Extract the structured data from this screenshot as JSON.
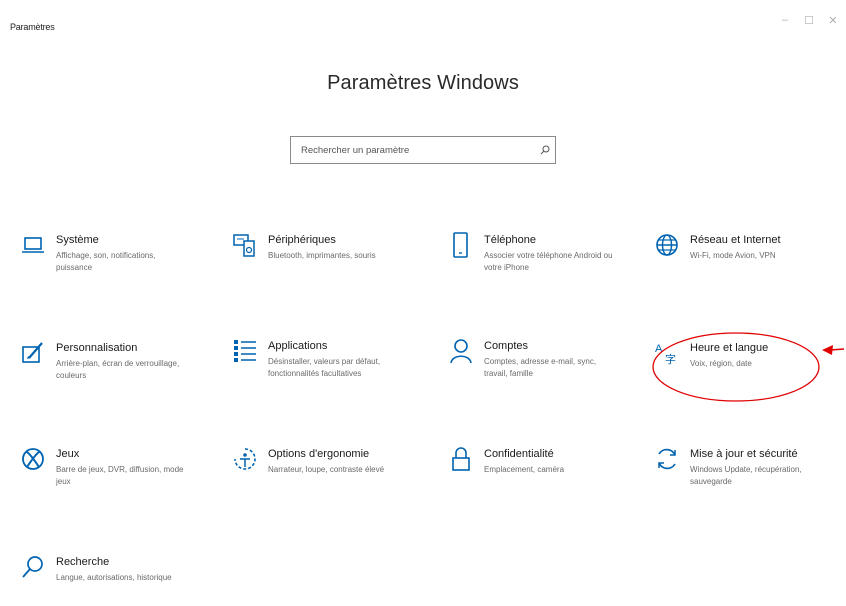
{
  "window": {
    "title": "Paramètres",
    "controls": {
      "minimize": "–",
      "maximize": "☐",
      "close": "✕"
    }
  },
  "header": {
    "title": "Paramètres Windows"
  },
  "search": {
    "placeholder": "Rechercher un paramètre"
  },
  "tiles": [
    {
      "name": "Système",
      "desc": "Affichage, son, notifications, puissance",
      "icon": "laptop-icon"
    },
    {
      "name": "Périphériques",
      "desc": "Bluetooth, imprimantes, souris",
      "icon": "devices-icon"
    },
    {
      "name": "Téléphone",
      "desc": "Associer votre téléphone Android ou votre iPhone",
      "icon": "phone-icon"
    },
    {
      "name": "Réseau et Internet",
      "desc": "Wi-Fi, mode Avion, VPN",
      "icon": "globe-icon"
    },
    {
      "name": "Personnalisation",
      "desc": "Arrière-plan, écran de verrouillage, couleurs",
      "icon": "personalization-icon"
    },
    {
      "name": "Applications",
      "desc": "Désinstaller, valeurs par défaut, fonctionnalités facultatives",
      "icon": "apps-list-icon"
    },
    {
      "name": "Comptes",
      "desc": "Comptes, adresse e-mail, sync, travail, famille",
      "icon": "person-icon"
    },
    {
      "name": "Heure et langue",
      "desc": "Voix, région, date",
      "icon": "time-language-icon"
    },
    {
      "name": "Jeux",
      "desc": "Barre de jeux, DVR, diffusion, mode jeux",
      "icon": "xbox-icon"
    },
    {
      "name": "Options d'ergonomie",
      "desc": "Narrateur, loupe, contraste élevé",
      "icon": "ease-of-access-icon"
    },
    {
      "name": "Confidentialité",
      "desc": "Emplacement, caméra",
      "icon": "lock-icon"
    },
    {
      "name": "Mise à jour et sécurité",
      "desc": "Windows Update, récupération, sauvegarde",
      "icon": "update-icon"
    },
    {
      "name": "Recherche",
      "desc": "Langue, autorisations, historique",
      "icon": "search-icon"
    }
  ],
  "colors": {
    "accent": "#0063b1",
    "annotation": "#e00000"
  }
}
